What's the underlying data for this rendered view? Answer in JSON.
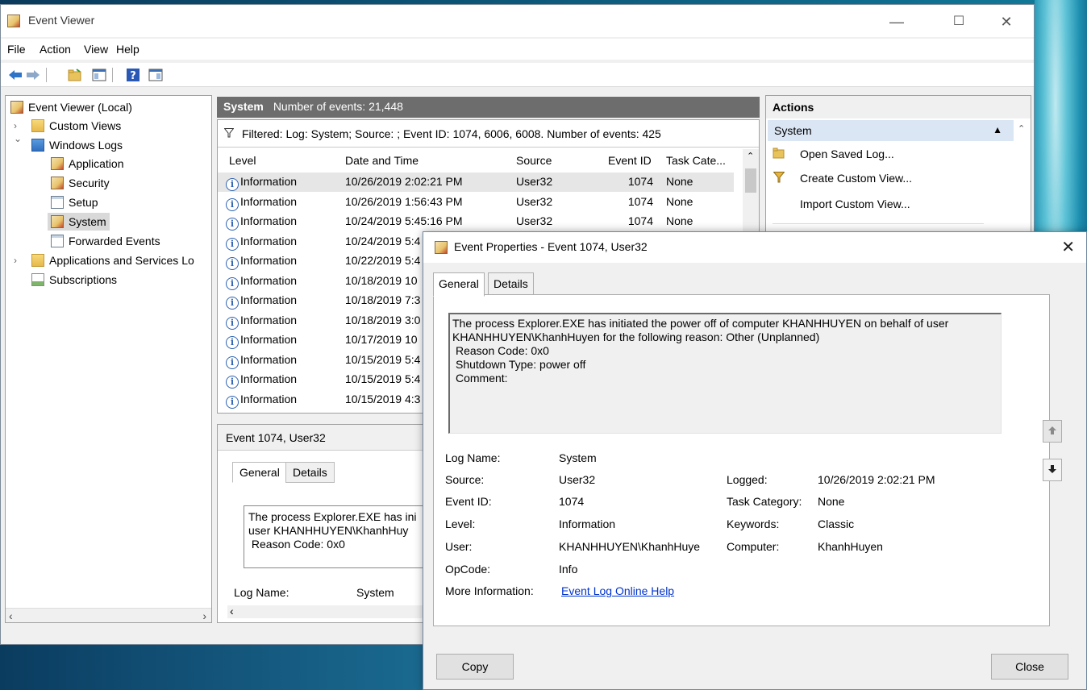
{
  "window": {
    "title": "Event Viewer",
    "minimize_glyph": "—",
    "maximize_glyph": "☐",
    "close_glyph": "✕"
  },
  "menu": [
    "File",
    "Action",
    "View",
    "Help"
  ],
  "toolbar_icons": [
    "back-arrow-icon",
    "forward-arrow-icon",
    "open-folder-icon",
    "console-tree-icon",
    "help-icon",
    "action-pane-icon"
  ],
  "tree": {
    "items": [
      {
        "label": "Event Viewer (Local)",
        "icon": "event-viewer-icon",
        "toggle": ""
      },
      {
        "label": "Custom Views",
        "icon": "folder-icon",
        "toggle": "›"
      },
      {
        "label": "Windows Logs",
        "icon": "folder-icon",
        "toggle": "⌄"
      },
      {
        "label": "Application",
        "icon": "log-icon",
        "toggle": ""
      },
      {
        "label": "Security",
        "icon": "log-icon",
        "toggle": ""
      },
      {
        "label": "Setup",
        "icon": "log-icon",
        "toggle": ""
      },
      {
        "label": "System",
        "icon": "log-icon",
        "toggle": ""
      },
      {
        "label": "Forwarded Events",
        "icon": "log-icon",
        "toggle": ""
      },
      {
        "label": "Applications and Services Lo",
        "icon": "folder-icon",
        "toggle": "›"
      },
      {
        "label": "Subscriptions",
        "icon": "subscriptions-icon",
        "toggle": ""
      }
    ],
    "selected": "System"
  },
  "center": {
    "log_name": "System",
    "event_count": "Number of events: 21,448",
    "filter_text": "Filtered: Log: System; Source: ; Event ID: 1074, 6006, 6008. Number of events: 425",
    "columns": [
      "Level",
      "Date and Time",
      "Source",
      "Event ID",
      "Task Cate..."
    ],
    "rows": [
      {
        "level": "Information",
        "date": "10/26/2019 2:02:21 PM",
        "source": "User32",
        "id": "1074",
        "task": "None"
      },
      {
        "level": "Information",
        "date": "10/26/2019 1:56:43 PM",
        "source": "User32",
        "id": "1074",
        "task": "None"
      },
      {
        "level": "Information",
        "date": "10/24/2019 5:45:16 PM",
        "source": "User32",
        "id": "1074",
        "task": "None"
      },
      {
        "level": "Information",
        "date": "10/24/2019 5:4",
        "source": "",
        "id": "",
        "task": ""
      },
      {
        "level": "Information",
        "date": "10/22/2019 5:4",
        "source": "",
        "id": "",
        "task": ""
      },
      {
        "level": "Information",
        "date": "10/18/2019 10",
        "source": "",
        "id": "",
        "task": ""
      },
      {
        "level": "Information",
        "date": "10/18/2019 7:3",
        "source": "",
        "id": "",
        "task": ""
      },
      {
        "level": "Information",
        "date": "10/18/2019 3:0",
        "source": "",
        "id": "",
        "task": ""
      },
      {
        "level": "Information",
        "date": "10/17/2019 10",
        "source": "",
        "id": "",
        "task": ""
      },
      {
        "level": "Information",
        "date": "10/15/2019 5:4",
        "source": "",
        "id": "",
        "task": ""
      },
      {
        "level": "Information",
        "date": "10/15/2019 5:4",
        "source": "",
        "id": "",
        "task": ""
      },
      {
        "level": "Information",
        "date": "10/15/2019 4:3",
        "source": "",
        "id": "",
        "task": ""
      }
    ],
    "detail": {
      "title": "Event 1074, User32",
      "tabs": [
        "General",
        "Details"
      ],
      "text_lines": [
        "The process Explorer.EXE has ini",
        "user KHANHHUYEN\\KhanhHuy",
        " Reason Code: 0x0"
      ],
      "log_name_label": "Log Name:",
      "log_name_value": "System"
    }
  },
  "actions": {
    "header": "Actions",
    "section": "System",
    "items": [
      {
        "label": "Open Saved Log...",
        "icon": "open-log-icon"
      },
      {
        "label": "Create Custom View...",
        "icon": "filter-icon"
      },
      {
        "label": "Import Custom View...",
        "icon": ""
      }
    ]
  },
  "dialog": {
    "title": "Event Properties - Event 1074, User32",
    "tabs": [
      "General",
      "Details"
    ],
    "description": [
      "The process Explorer.EXE has initiated the power off of computer KHANHHUYEN on behalf of user",
      "KHANHHUYEN\\KhanhHuyen for the following reason: Other (Unplanned)",
      " Reason Code: 0x0",
      " Shutdown Type: power off",
      " Comment:"
    ],
    "fields": {
      "log_name_label": "Log Name:",
      "log_name": "System",
      "source_label": "Source:",
      "source": "User32",
      "logged_label": "Logged:",
      "logged": "10/26/2019 2:02:21 PM",
      "event_id_label": "Event ID:",
      "event_id": "1074",
      "task_label": "Task Category:",
      "task": "None",
      "level_label": "Level:",
      "level": "Information",
      "keywords_label": "Keywords:",
      "keywords": "Classic",
      "user_label": "User:",
      "user": "KHANHHUYEN\\KhanhHuye",
      "computer_label": "Computer:",
      "computer": "KhanhHuyen",
      "opcode_label": "OpCode:",
      "opcode": "Info",
      "more_info_label": "More Information:",
      "more_info_link": "Event Log Online Help"
    },
    "copy_label": "Copy",
    "close_label": "Close"
  }
}
